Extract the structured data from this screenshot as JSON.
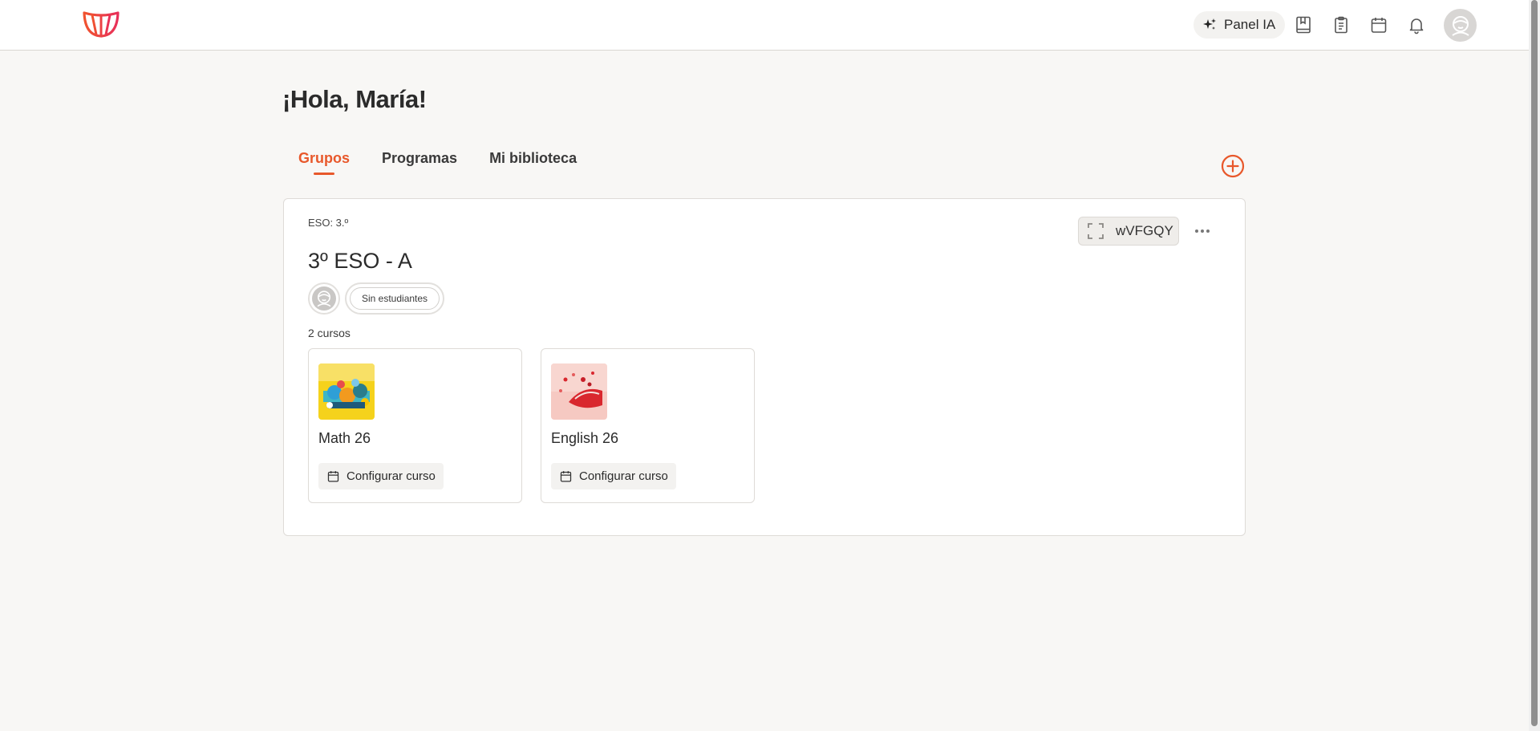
{
  "header": {
    "panel_ia_label": "Panel IA",
    "icons": [
      "sparkle-icon",
      "bookmark-book-icon",
      "clipboard-icon",
      "calendar-icon",
      "bell-icon",
      "user-avatar-icon"
    ],
    "accent_color": "#e8582b"
  },
  "greeting": "¡Hola, María!",
  "tabs": [
    {
      "label": "Grupos",
      "active": true
    },
    {
      "label": "Programas",
      "active": false
    },
    {
      "label": "Mi biblioteca",
      "active": false
    }
  ],
  "group": {
    "level": "ESO: 3.º",
    "name": "3º ESO - A",
    "students_label": "Sin estudiantes",
    "course_count": "2 cursos",
    "code": "wVFGQY",
    "courses": [
      {
        "title": "Math 26",
        "config_label": "Configurar curso"
      },
      {
        "title": "English 26",
        "config_label": "Configurar curso"
      }
    ]
  }
}
